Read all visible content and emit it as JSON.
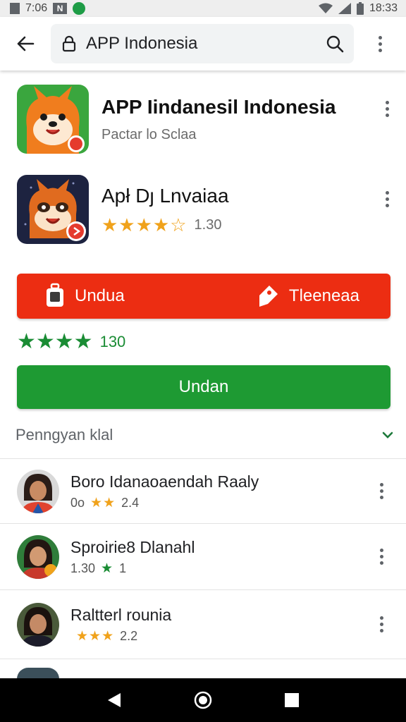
{
  "status_bar": {
    "time_left": "7:06",
    "time_right": "18:33"
  },
  "toolbar": {
    "url_text": "APP Indonesia",
    "back_icon": "arrow-left-icon",
    "lock_icon": "lock-icon",
    "search_icon": "search-icon",
    "menu_icon": "kebab-menu-icon"
  },
  "apps": [
    {
      "title": "APP Iindanesil Indonesia",
      "subtitle": "Pactar lo Sclaa"
    },
    {
      "title": "Apł Dȷ Lnvaiaa",
      "stars": "★★★★☆",
      "rating": "1.30"
    }
  ],
  "action_bar": {
    "download_label": "Undua",
    "other_label": "Tleeneaa"
  },
  "summary_rating": {
    "stars": "★★★★",
    "value": "130"
  },
  "install_button": {
    "label": "Undan"
  },
  "reviews_section": {
    "title": "Penngyan klal"
  },
  "reviews": [
    {
      "name": "Boro Idanaoaendah Raaly",
      "prefix": "0o",
      "stars": "★★",
      "score": "2.4"
    },
    {
      "name": "Sproirie8 Dlanahl",
      "prefix": "1.30",
      "stars": "★",
      "score": "1"
    },
    {
      "name": "Raltterl rounia",
      "prefix": "",
      "stars": "★★★",
      "score": "2.2"
    }
  ],
  "colors": {
    "brand_red": "#ec2d12",
    "brand_green": "#1e9a33",
    "star_gold": "#f0a21b",
    "star_green": "#1a8c34"
  }
}
